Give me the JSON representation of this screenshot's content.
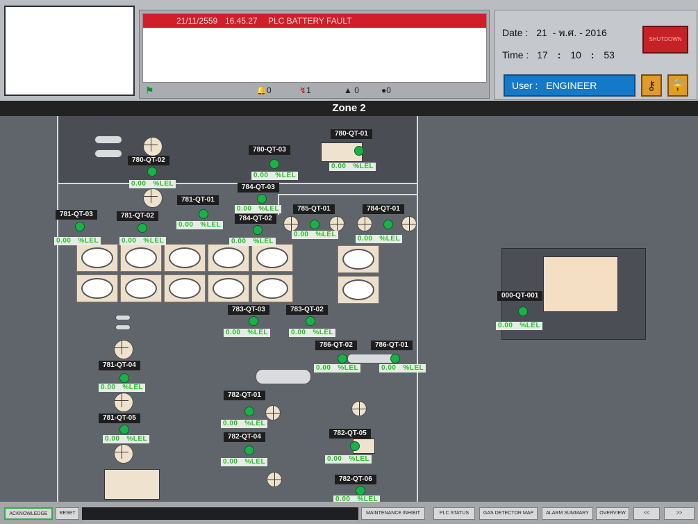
{
  "alarm": {
    "date": "21/11/2559",
    "time": "16.45.27",
    "message": "PLC BATTERY FAULT",
    "counts": {
      "bell": "0",
      "arrow": "1",
      "person": "0",
      "question": "0"
    }
  },
  "datetime": {
    "date_label": "Date :",
    "day": "21",
    "month": "พ.ศ.",
    "year": "2016",
    "time_label": "Time :",
    "hour": "17",
    "minute": "10",
    "second": "53"
  },
  "shutdown_label": "SHUTDOWN",
  "user": {
    "label": "User :",
    "name": "ENGINEER"
  },
  "zone_title": "Zone 2",
  "unit": "%LEL",
  "sensors": [
    {
      "tag": "780-QT-01",
      "value": "0.00"
    },
    {
      "tag": "780-QT-02",
      "value": "0.00"
    },
    {
      "tag": "780-QT-03",
      "value": "0.00"
    },
    {
      "tag": "781-QT-01",
      "value": "0.00"
    },
    {
      "tag": "781-QT-02",
      "value": "0.00"
    },
    {
      "tag": "781-QT-03",
      "value": "0.00"
    },
    {
      "tag": "781-QT-04",
      "value": "0.00"
    },
    {
      "tag": "781-QT-05",
      "value": "0.00"
    },
    {
      "tag": "782-QT-01",
      "value": "0.00"
    },
    {
      "tag": "782-QT-04",
      "value": "0.00"
    },
    {
      "tag": "782-QT-05",
      "value": "0.00"
    },
    {
      "tag": "782-QT-06",
      "value": "0.00"
    },
    {
      "tag": "783-QT-02",
      "value": "0.00"
    },
    {
      "tag": "783-QT-03",
      "value": "0.00"
    },
    {
      "tag": "784-QT-01",
      "value": "0.00"
    },
    {
      "tag": "784-QT-02",
      "value": "0.00"
    },
    {
      "tag": "784-QT-03",
      "value": "0.00"
    },
    {
      "tag": "785-QT-01",
      "value": "0.00"
    },
    {
      "tag": "786-QT-01",
      "value": "0.00"
    },
    {
      "tag": "786-QT-02",
      "value": "0.00"
    },
    {
      "tag": "000-QT-001",
      "value": "0.00"
    }
  ],
  "buttons": {
    "acknowledge": "ACKNOWLEDGE",
    "reset": "RESET",
    "maintenance": "MAINTENANCE INHIBIT",
    "plc_status": "PLC STATUS",
    "gas_detector": "GAS DETECTOR MAP",
    "alarm_summary": "ALARM SUMMARY",
    "overview": "OVERVIEW",
    "prev": "<<",
    "next": ">>"
  },
  "colors": {
    "alarm_red": "#d11f2a",
    "user_blue": "#1479c8",
    "led_green": "#1bb14a"
  }
}
